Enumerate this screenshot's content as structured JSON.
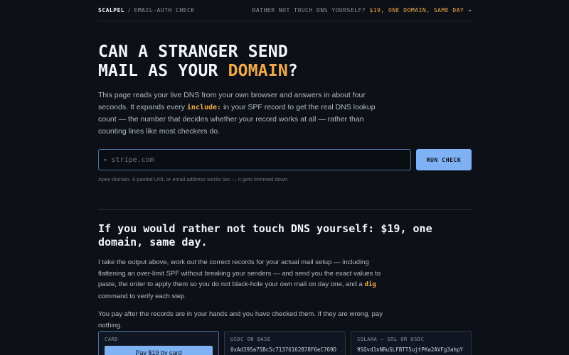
{
  "header": {
    "brand": "SCALPEL",
    "separator": "/",
    "crumb": "EMAIL-AUTH CHECK",
    "cta_prefix": "RATHER NOT TOUCH DNS YOURSELF?",
    "cta_link": "$19, ONE DOMAIN, SAME DAY →"
  },
  "hero": {
    "title_line1": "CAN A STRANGER SEND",
    "title_line2_prefix": "MAIL AS YOUR ",
    "title_accent": "DOMAIN",
    "title_suffix": "?",
    "lead_part1": "This page reads your live DNS from your own browser and answers in about four seconds. It expands every ",
    "lead_code": "include:",
    "lead_part2": " in your SPF record to get the real DNS lookup count — the number that decides whether your record works at all — rather than counting lines like most checkers do."
  },
  "form": {
    "prompt_glyph": "▸",
    "placeholder": "stripe.com",
    "value": "",
    "button_label": "RUN CHECK",
    "hint": "Apex domain. A pasted URL or email address works too — it gets trimmed down."
  },
  "service": {
    "title": "If you would rather not touch DNS yourself: $19, one domain, same day.",
    "para1_part1": "I take the output above, work out the correct records for your actual mail setup — including flattening an over-limit SPF without breaking your senders — and send you the exact values to paste, the order to apply them so you do not black-hole your own mail on day one, and a ",
    "para1_code": "dig",
    "para1_part2": " command to verify each step.",
    "para2": "You pay after the records are in your hands and you have checked them. If they are wrong, pay nothing."
  },
  "payment": {
    "card_label": "CARD",
    "card_button": "Pay $19 by card",
    "usdc_label": "USDC ON BASE",
    "usdc_address": "0xAd395a75Bc5c71376162B78F6eC769D",
    "solana_label": "SOLANA — SOL OR USDC",
    "solana_address": "9SQvd1nNRuSLFBTT5ujtPKa2AVFg3ahpY"
  },
  "colors": {
    "background": "#0d1117",
    "accent": "#f0a94a",
    "button": "#7fb2f5"
  }
}
